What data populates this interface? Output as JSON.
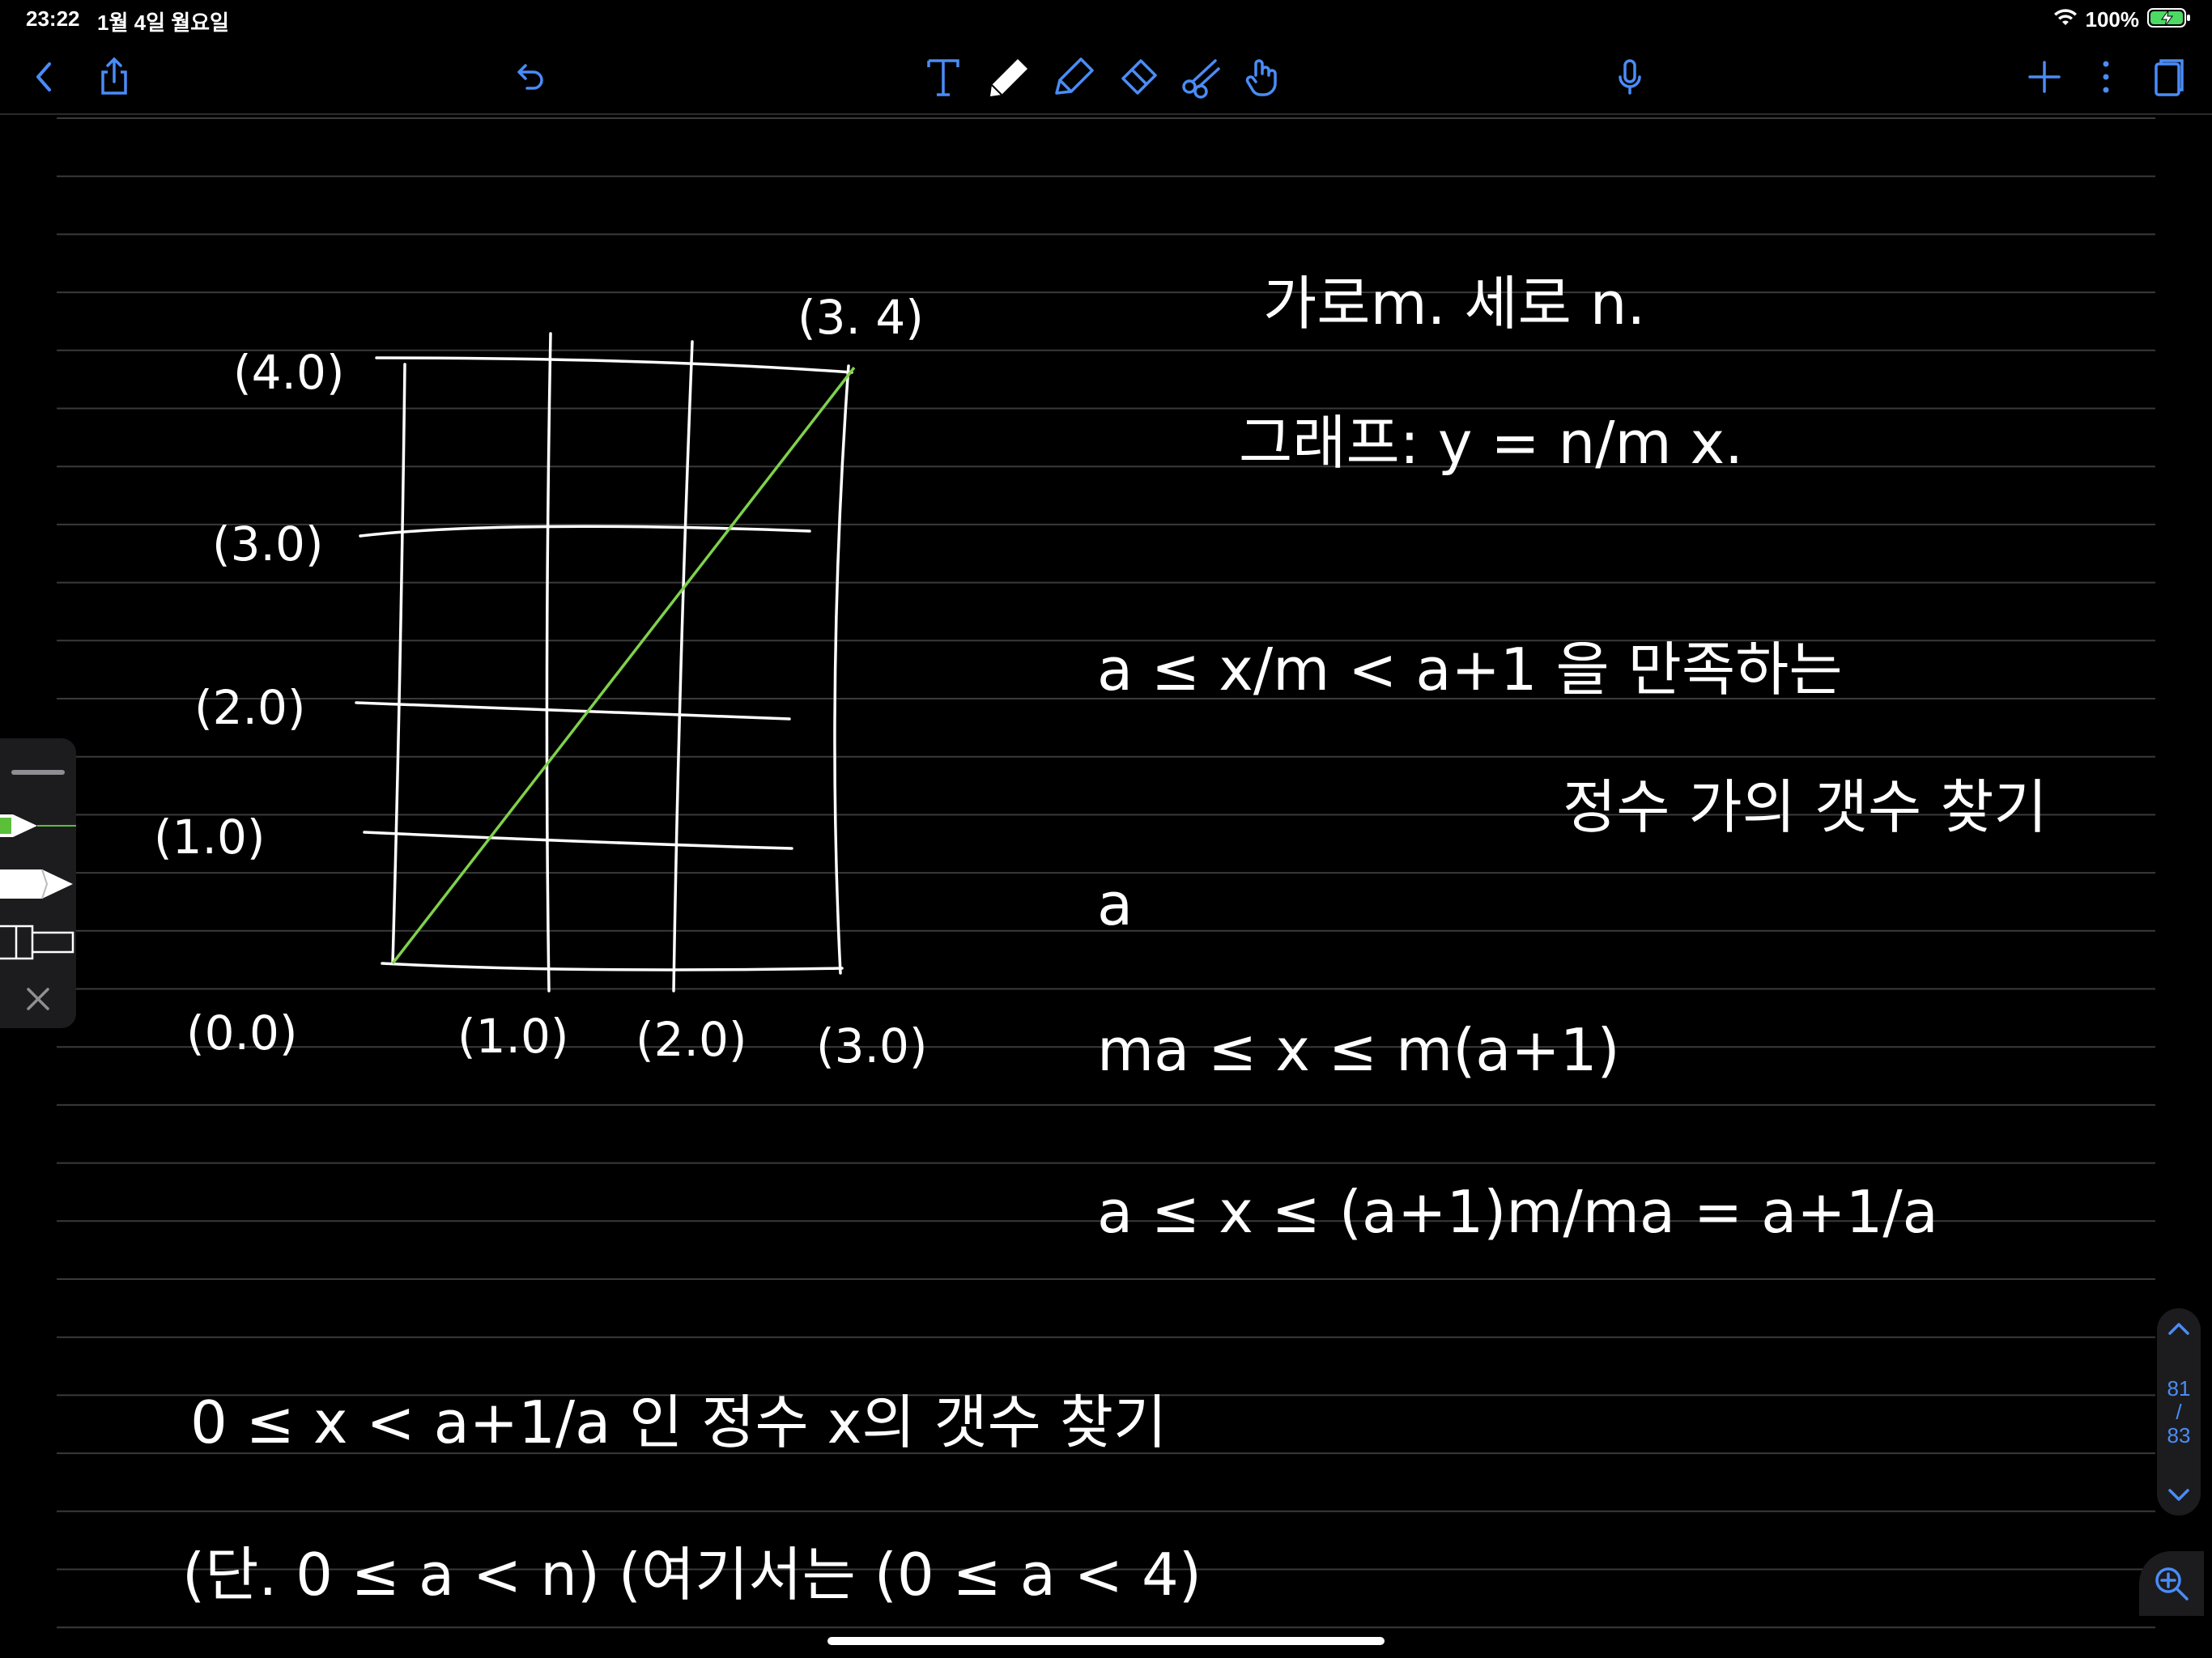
{
  "status_bar": {
    "time": "23:22",
    "date": "1월 4일 월요일",
    "battery_percent": "100%"
  },
  "toolbar": {
    "icons": [
      "back-icon",
      "share-icon",
      "undo-icon",
      "text-tool-icon",
      "pen-tool-icon",
      "highlighter-tool-icon",
      "eraser-tool-icon",
      "lasso-tool-icon",
      "pointer-tool-icon",
      "microphone-icon",
      "add-page-icon",
      "more-icon",
      "pages-icon"
    ],
    "accent_color": "#4a8cf7",
    "active_tool": "pen"
  },
  "pen_panel": {
    "pens": [
      {
        "icon": "green-pen-icon",
        "color": "#5bbf3a"
      },
      {
        "icon": "white-pen-icon",
        "color": "#ffffff"
      },
      {
        "icon": "marker-icon",
        "color": "#000000"
      }
    ]
  },
  "pager": {
    "current": "81",
    "separator": "/",
    "total": "83"
  },
  "note": {
    "paper": "lined",
    "line_color": "#3a3a3a",
    "ink_color": "#ffffff",
    "diagonal_color": "#7fd14b",
    "grid_labels": {
      "top_right": "(3. 4)",
      "y4": "(4.0)",
      "y3": "(3.0)",
      "y2": "(2.0)",
      "y1": "(1.0)",
      "origin": "(0.0)",
      "x1": "(1.0)",
      "x2": "(2.0)",
      "x3": "(3.0)"
    },
    "lines": [
      "가로m. 세로 n.",
      "그래프:  y = n/m x.",
      "a ≤ x/m < a+1  을 만족하는",
      "정수 가의 갯수 찾기",
      "a",
      "ma ≤ x ≤ m(a+1)",
      "a ≤ x ≤ (a+1)m/ma = a+1/a",
      "0 ≤ x < a+1/a 인 정수 x의 갯수 찾기",
      "(단.  0 ≤ a < n) (여기서는 (0 ≤ a < 4)"
    ]
  }
}
